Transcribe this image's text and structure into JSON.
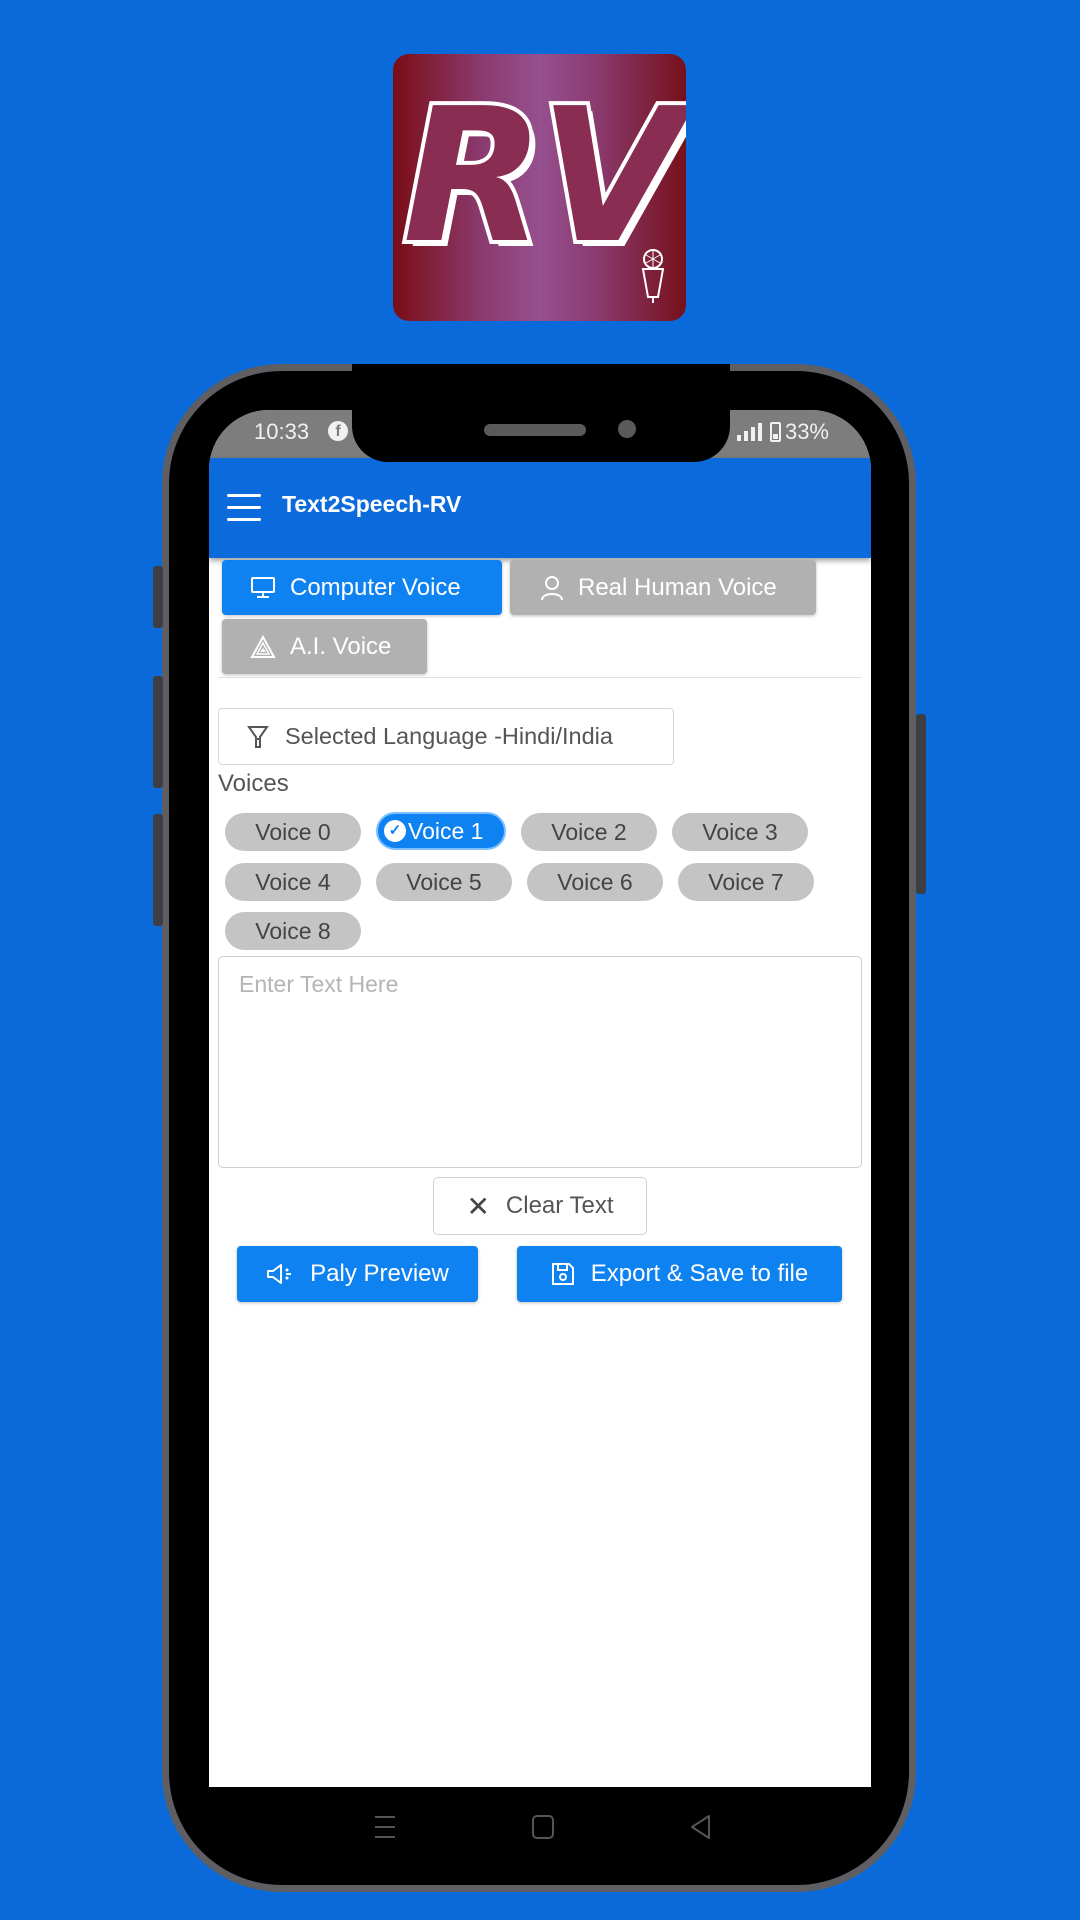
{
  "logo": {
    "text": "RV",
    "alt": "Text2Speech-RV app logo"
  },
  "status_bar": {
    "time": "10:33",
    "notification_icon": "facebook-icon",
    "battery": "33%"
  },
  "app_bar": {
    "title": "Text2Speech-RV",
    "menu_icon": "hamburger-menu-icon"
  },
  "tabs": [
    {
      "label": "Computer Voice",
      "icon": "monitor-icon",
      "active": true
    },
    {
      "label": "Real Human Voice",
      "icon": "person-icon",
      "active": false
    },
    {
      "label": "A.I. Voice",
      "icon": "triangle-icon",
      "active": false
    }
  ],
  "language": {
    "label": "Selected Language -Hindi/India",
    "icon": "filter-icon"
  },
  "voices": {
    "label": "Voices",
    "items": [
      "Voice 0",
      "Voice 1",
      "Voice 2",
      "Voice 3",
      "Voice 4",
      "Voice 5",
      "Voice 6",
      "Voice 7",
      "Voice 8"
    ],
    "selected": "Voice 1"
  },
  "text_input": {
    "placeholder": "Enter Text Here",
    "value": ""
  },
  "buttons": {
    "clear": "Clear Text",
    "play": "Paly Preview",
    "export": "Export & Save to file"
  },
  "colors": {
    "background": "#0b6ad9",
    "accent": "#0f82f2",
    "app_bar": "#0c6bdc",
    "inactive": "#b1b1b1"
  }
}
